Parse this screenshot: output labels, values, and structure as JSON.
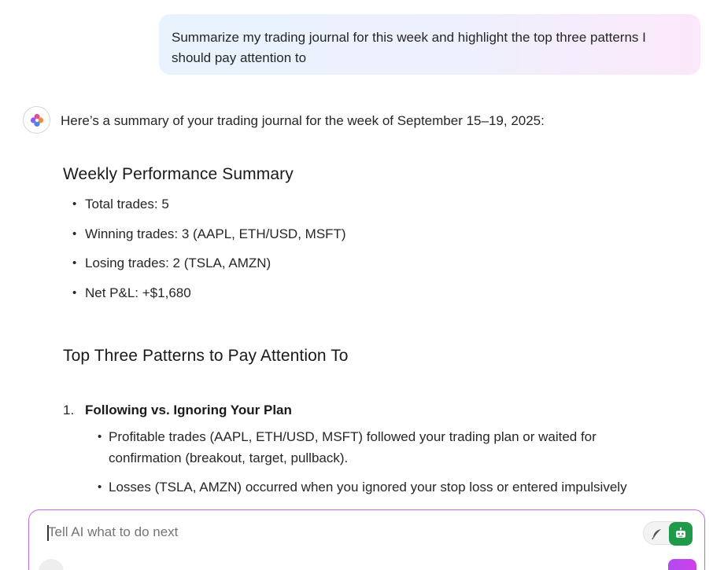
{
  "conversation": {
    "user_message": "Summarize my trading journal for this week and highlight the top three patterns I should pay attention to",
    "ai_intro": "Here’s a summary of your trading journal for the week of September 15–19, 2025:",
    "summary_heading": "Weekly Performance Summary",
    "summary_items": [
      "Total trades: 5",
      "Winning trades: 3 (AAPL, ETH/USD, MSFT)",
      "Losing trades: 2 (TSLA, AMZN)",
      "Net P&L: +$1,680"
    ],
    "patterns_heading": "Top Three Patterns to Pay Attention To",
    "pattern_1": {
      "number": "1.",
      "title": "Following vs. Ignoring Your Plan",
      "points": [
        "Profitable trades (AAPL, ETH/USD, MSFT) followed your trading plan or waited for confirmation (breakout, target, pullback).",
        "Losses (TSLA, AMZN) occurred when you ignored your stop loss or entered impulsively"
      ]
    }
  },
  "composer": {
    "placeholder": "Tell AI what to do next"
  },
  "icons": {
    "ai_avatar": "colorful-flower-icon",
    "feather": "feather-icon",
    "bot": "robot-icon"
  },
  "colors": {
    "composer_border": "#c46be8",
    "bot_button": "#1f9a4a",
    "accent_gradient_end": "#d040e8"
  }
}
